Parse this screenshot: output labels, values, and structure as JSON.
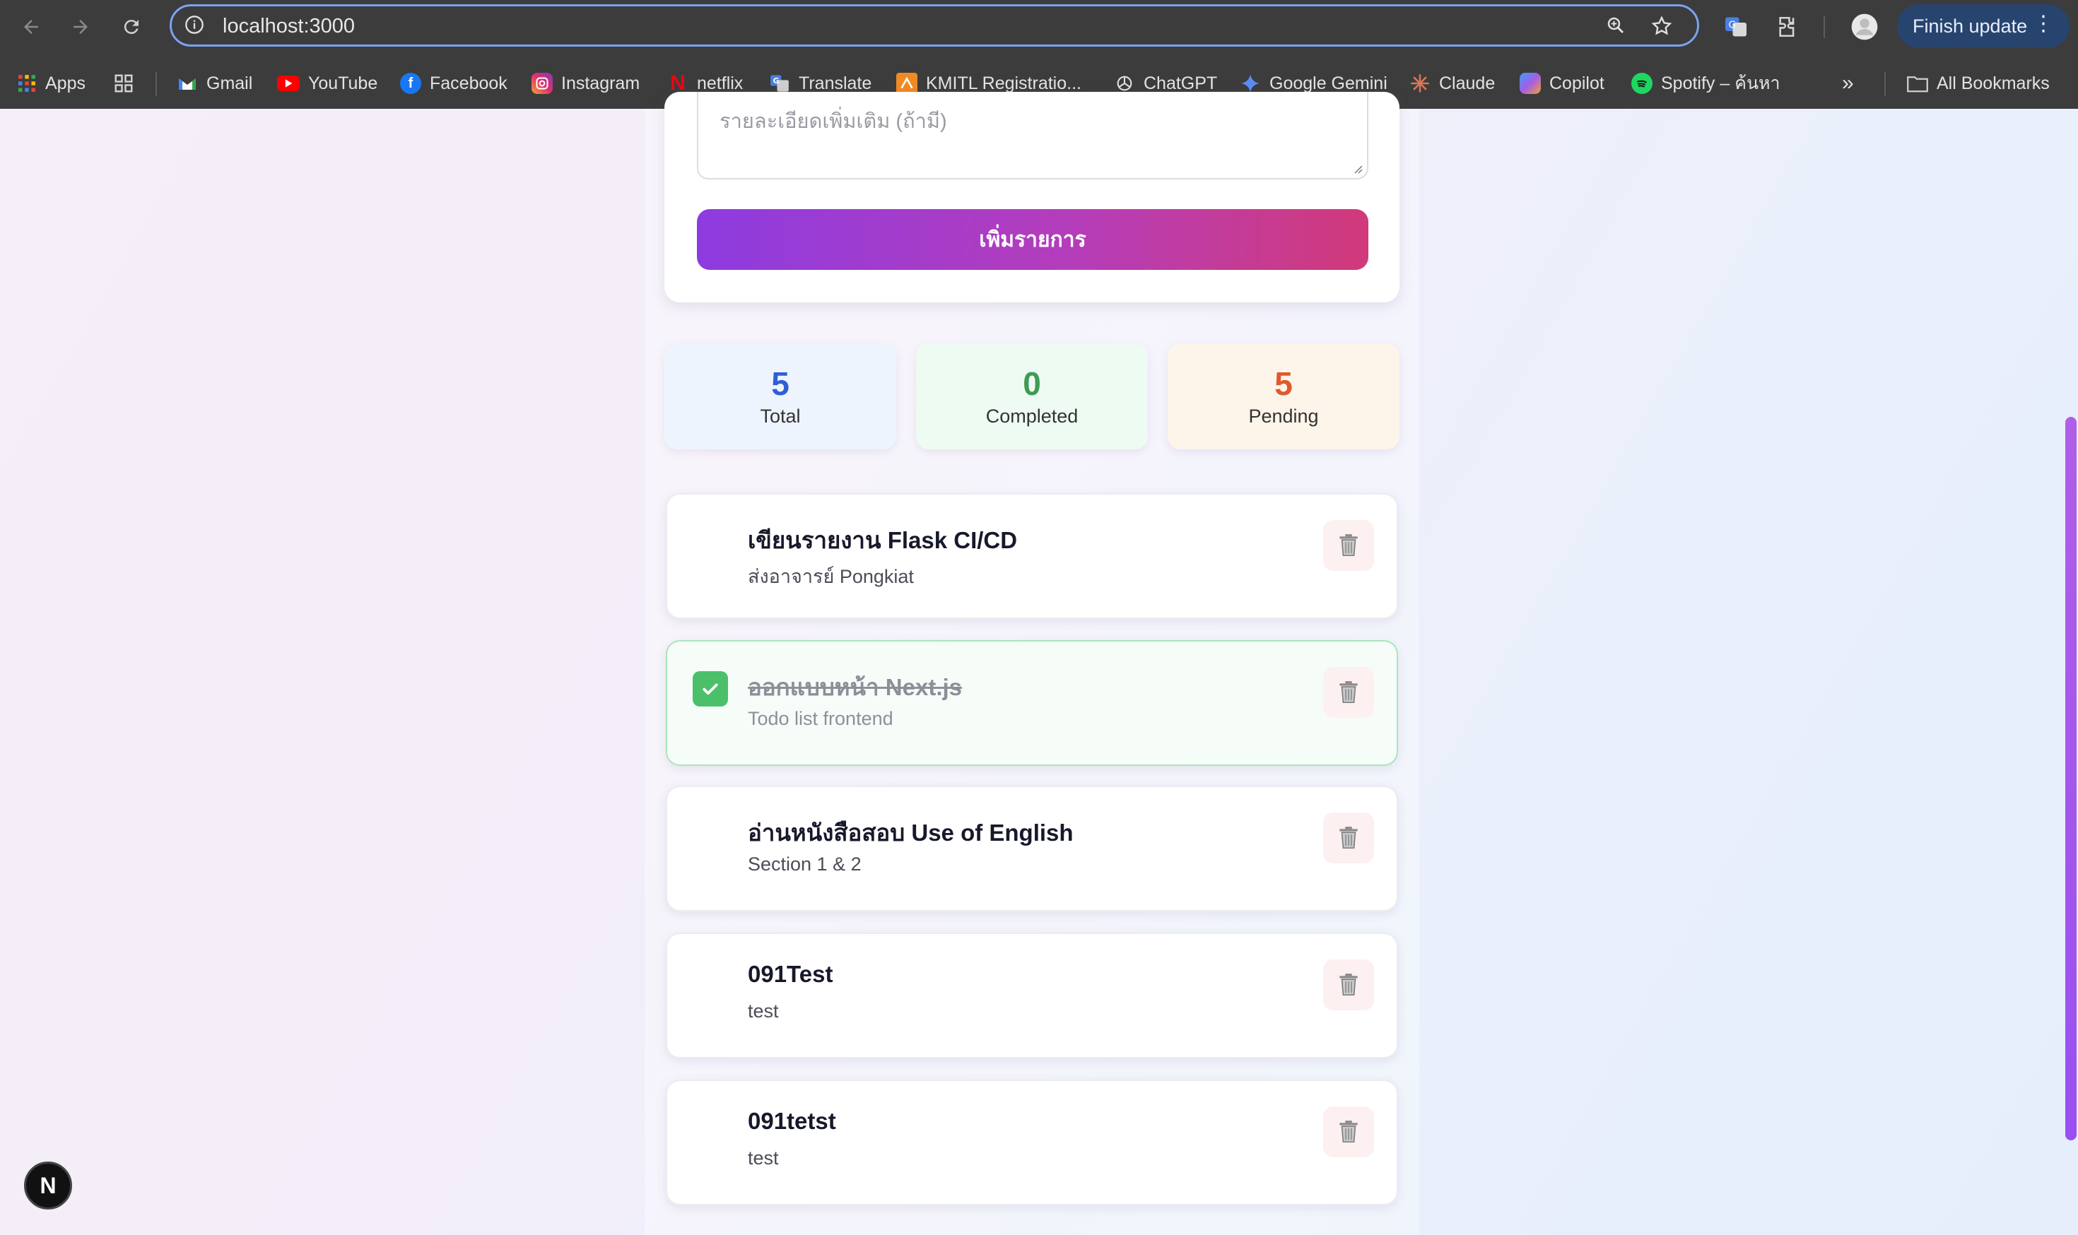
{
  "browser": {
    "url": "localhost:3000",
    "finish_update": "Finish update",
    "bookmarks": [
      {
        "label": "Apps",
        "icon": "apps-grid-icon"
      },
      {
        "label": "Gmail",
        "icon": "gmail-icon"
      },
      {
        "label": "YouTube",
        "icon": "youtube-icon"
      },
      {
        "label": "Facebook",
        "icon": "facebook-icon"
      },
      {
        "label": "Instagram",
        "icon": "instagram-icon"
      },
      {
        "label": "netflix",
        "icon": "netflix-icon"
      },
      {
        "label": "Translate",
        "icon": "translate-icon"
      },
      {
        "label": "KMITL Registratio...",
        "icon": "kmitl-icon"
      },
      {
        "label": "ChatGPT",
        "icon": "chatgpt-icon"
      },
      {
        "label": "Google Gemini",
        "icon": "gemini-icon"
      },
      {
        "label": "Claude",
        "icon": "claude-icon"
      },
      {
        "label": "Copilot",
        "icon": "copilot-icon"
      },
      {
        "label": "Spotify – ค้นหา",
        "icon": "spotify-icon"
      }
    ],
    "all_bookmarks": "All Bookmarks"
  },
  "form": {
    "description_placeholder": "รายละเอียดเพิ่มเติม (ถ้ามี)",
    "add_button": "เพิ่มรายการ"
  },
  "stats": {
    "total": {
      "value": "5",
      "label": "Total",
      "color": "#2f5fd6"
    },
    "completed": {
      "value": "0",
      "label": "Completed",
      "color": "#3f9b55"
    },
    "pending": {
      "value": "5",
      "label": "Pending",
      "color": "#e0592a"
    }
  },
  "todos": [
    {
      "title": "เขียนรายงาน Flask CI/CD",
      "description": "ส่งอาจารย์ Pongkiat",
      "completed": false
    },
    {
      "title": "ออกแบบหน้า Next.js",
      "description": "Todo list frontend",
      "completed": true
    },
    {
      "title": "อ่านหนังสือสอบ Use of English",
      "description": "Section 1 & 2",
      "completed": false
    },
    {
      "title": "091Test",
      "description": "test",
      "completed": false
    },
    {
      "title": "091tetst",
      "description": "test",
      "completed": false
    }
  ],
  "dev_badge": "N"
}
